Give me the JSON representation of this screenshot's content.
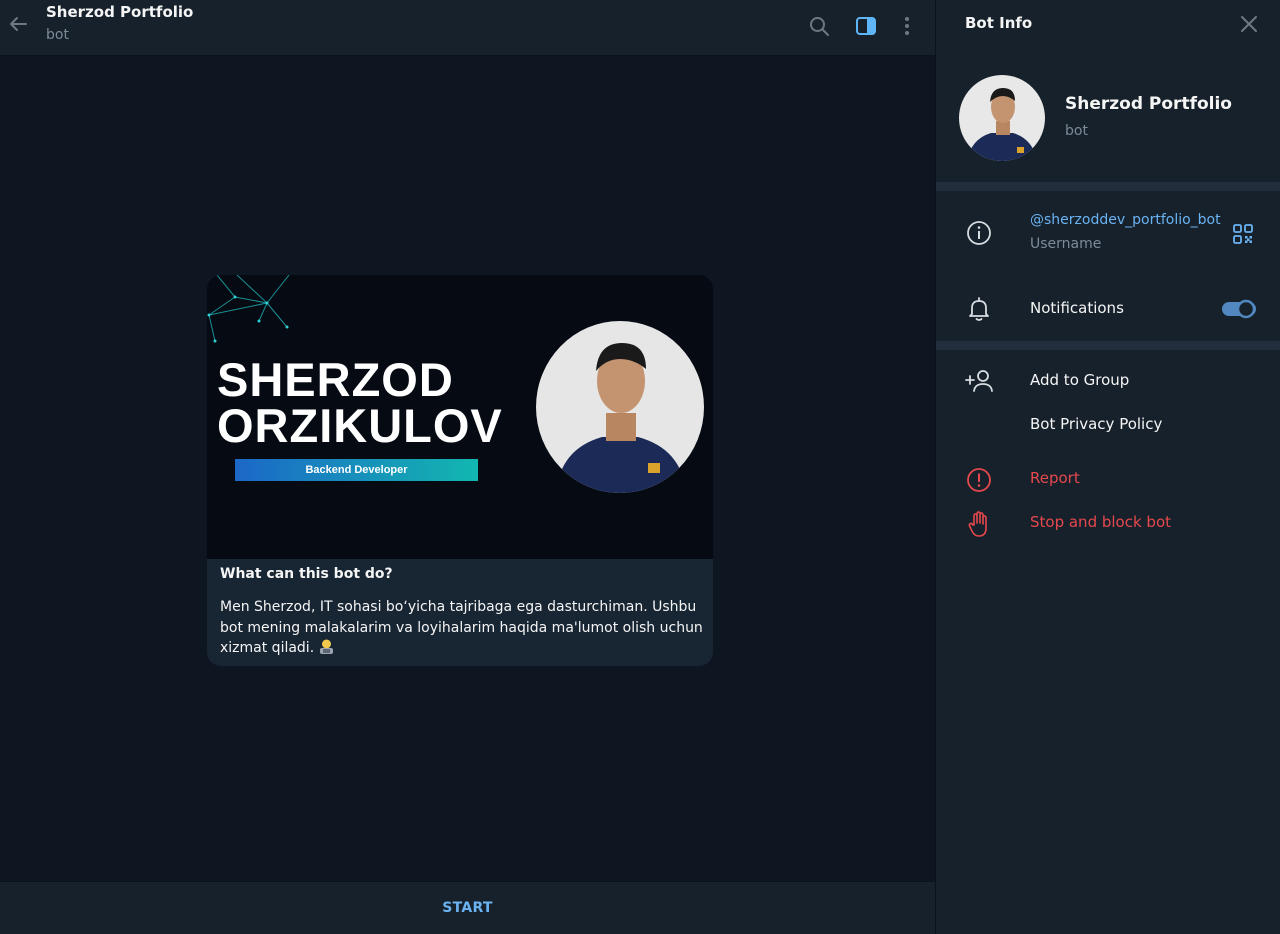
{
  "header": {
    "title": "Sherzod Portfolio",
    "subtitle": "bot",
    "icons": [
      "back-arrow-icon",
      "search-icon",
      "sidebar-toggle-icon",
      "more-vertical-icon"
    ]
  },
  "intro_card": {
    "banner": {
      "name_line1": "SHERZOD",
      "name_line2": "ORZIKULOV",
      "role": "Backend Developer"
    },
    "title": "What can this bot do?",
    "text": "Men Sherzod, IT sohasi bo‘yicha tajribaga ega dasturchiman. Ushbu bot mening malakalarim va loyihalarim haqida ma'lumot olish uchun xizmat qiladi."
  },
  "footer": {
    "start_label": "START"
  },
  "panel": {
    "title": "Bot Info",
    "profile": {
      "name": "Sherzod Portfolio",
      "subtitle": "bot"
    },
    "username": "@sherzoddev_portfolio_bot",
    "username_label": "Username",
    "notifications_label": "Notifications",
    "notifications_on": true,
    "add_to_group_label": "Add to Group",
    "privacy_label": "Bot Privacy Policy",
    "report_label": "Report",
    "block_label": "Stop and block bot"
  },
  "colors": {
    "accent": "#6ab3f3",
    "danger": "#e5484d",
    "toggle": "#5288c1",
    "background": "#0e1621",
    "surface": "#17212b",
    "bubble": "#182533"
  }
}
